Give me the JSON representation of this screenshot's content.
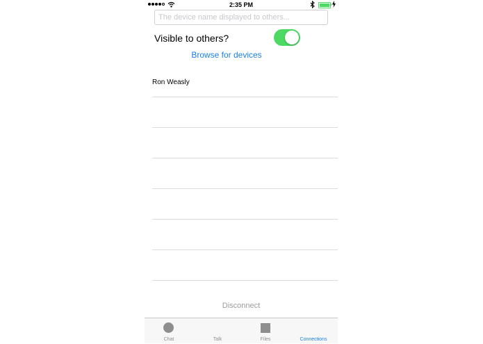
{
  "status_bar": {
    "time": "2:35 PM",
    "signal_icon": "signal-dots-icon",
    "wifi_icon": "wifi-icon",
    "bluetooth_icon": "bluetooth-icon",
    "battery_icon": "battery-icon",
    "battery_level": 1.0
  },
  "device_name_field": {
    "placeholder": "The device name displayed to others...",
    "value": ""
  },
  "visibility": {
    "label": "Visible to others?",
    "on": true,
    "accent_color": "#4cd964"
  },
  "browse_label": "Browse for devices",
  "devices": [
    {
      "name": "Ron Weasly"
    },
    {
      "name": ""
    },
    {
      "name": ""
    },
    {
      "name": ""
    },
    {
      "name": ""
    },
    {
      "name": ""
    },
    {
      "name": ""
    }
  ],
  "disconnect_label": "Disconnect",
  "tabs": [
    {
      "label": "Chat",
      "icon": "circle-icon"
    },
    {
      "label": "Talk",
      "icon": ""
    },
    {
      "label": "Files",
      "icon": "square-icon"
    },
    {
      "label": "Connections",
      "icon": "",
      "active": true
    }
  ],
  "colors": {
    "link": "#1a7ff0",
    "inactive_tab": "#8e8e8e"
  }
}
